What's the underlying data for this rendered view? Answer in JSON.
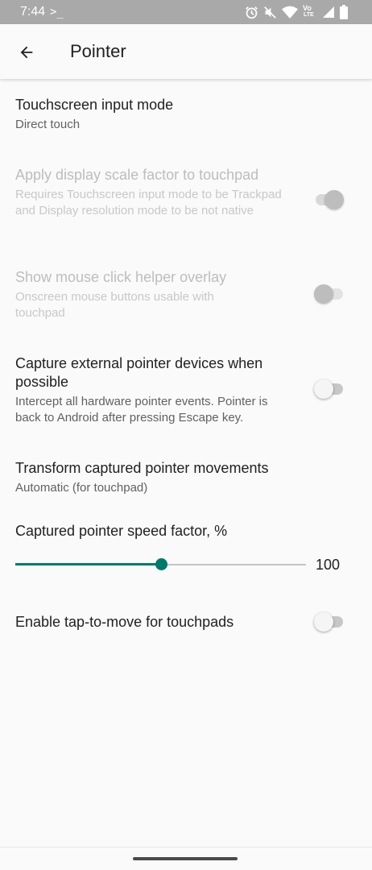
{
  "status_bar": {
    "time": "7:44",
    "prompt": ">_",
    "icons": [
      "alarm-icon",
      "mute-icon",
      "wifi-icon",
      "volte-icon",
      "signal-icon",
      "battery-icon"
    ],
    "volte_label": "Vo",
    "lte_label": "LTE"
  },
  "app_bar": {
    "back_icon": "arrow-left-icon",
    "title": "Pointer"
  },
  "preferences": {
    "input_mode": {
      "title": "Touchscreen input mode",
      "summary": "Direct touch"
    },
    "scale_factor": {
      "title": "Apply display scale factor to touchpad",
      "summary": "Requires Touchscreen input mode to be Trackpad and Display resolution mode to be not native",
      "checked": true,
      "enabled": false
    },
    "click_helper": {
      "title": "Show mouse click helper overlay",
      "summary": "Onscreen mouse buttons usable with touchpad",
      "checked": false,
      "enabled": false
    },
    "capture_pointer": {
      "title": "Capture external pointer devices when possible",
      "summary": "Intercept all hardware pointer events. Pointer is back to Android after pressing Escape key.",
      "checked": false,
      "enabled": true
    },
    "transform_movements": {
      "title": "Transform captured pointer movements",
      "summary": "Automatic (for touchpad)"
    },
    "speed_factor": {
      "title": "Captured pointer speed factor, %",
      "value": "100",
      "position_fraction": 0.5,
      "accent_color": "#00796b"
    },
    "tap_to_move": {
      "title": "Enable tap-to-move for touchpads",
      "checked": false,
      "enabled": true
    }
  }
}
